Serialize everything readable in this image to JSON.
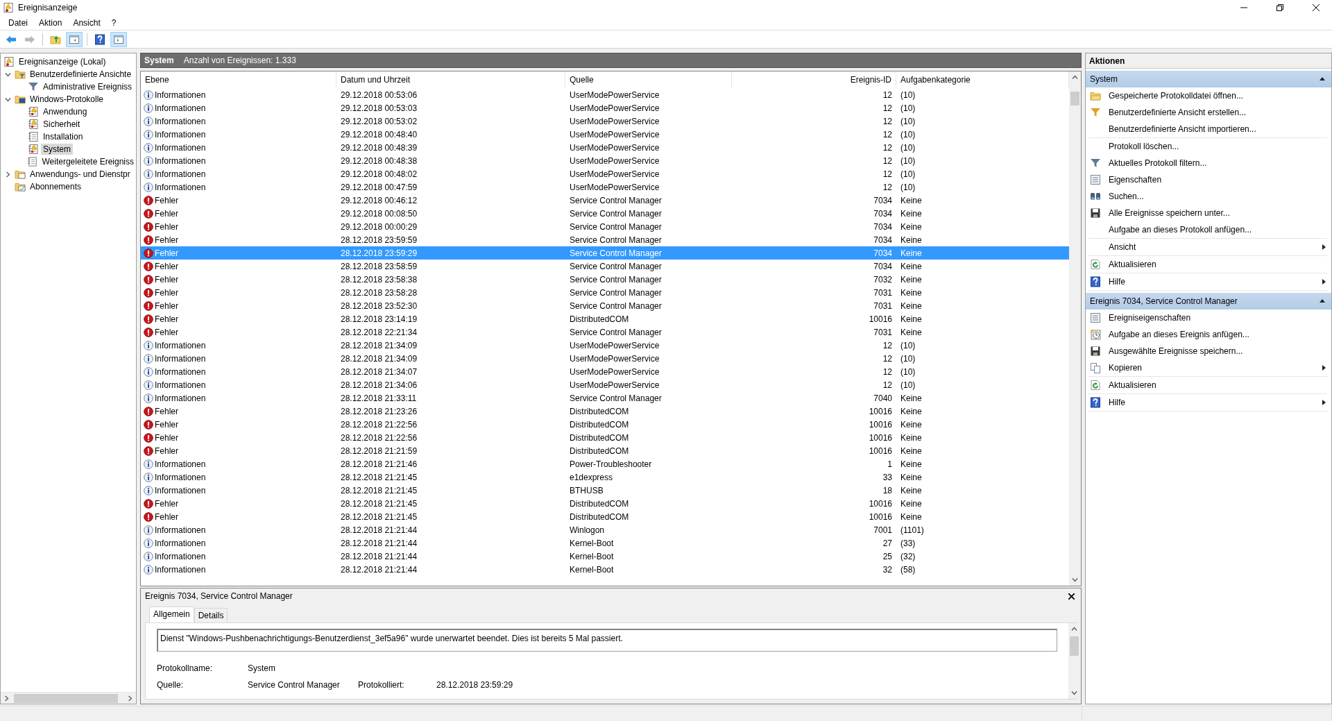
{
  "window": {
    "title": "Ereignisanzeige"
  },
  "menu": [
    "Datei",
    "Aktion",
    "Ansicht",
    "?"
  ],
  "toolbar": [
    {
      "kind": "back",
      "disabled": false,
      "pressed": false
    },
    {
      "kind": "forward",
      "disabled": true,
      "pressed": false
    },
    {
      "kind": "separator"
    },
    {
      "kind": "up-folder",
      "disabled": false,
      "pressed": false
    },
    {
      "kind": "tree-pane",
      "disabled": false,
      "pressed": true
    },
    {
      "kind": "separator"
    },
    {
      "kind": "help",
      "disabled": false,
      "pressed": false
    },
    {
      "kind": "action-pane",
      "disabled": false,
      "pressed": true
    }
  ],
  "tree": [
    {
      "label": "Ereignisanzeige (Lokal)",
      "kind": "viewer",
      "selected": false,
      "children": [
        {
          "label": "Benutzerdefinierte Ansichte",
          "kind": "folder-filter",
          "selected": false,
          "expanded": true,
          "children": [
            {
              "label": "Administrative Ereigniss",
              "kind": "filter",
              "selected": false
            }
          ]
        },
        {
          "label": "Windows-Protokolle",
          "kind": "folder-computer",
          "selected": false,
          "expanded": true,
          "children": [
            {
              "label": "Anwendung",
              "kind": "log-warning",
              "selected": false
            },
            {
              "label": "Sicherheit",
              "kind": "log-warning",
              "selected": false
            },
            {
              "label": "Installation",
              "kind": "log",
              "selected": false
            },
            {
              "label": "System",
              "kind": "log-warning",
              "selected": true
            },
            {
              "label": "Weitergeleitete Ereigniss",
              "kind": "log",
              "selected": false
            }
          ]
        },
        {
          "label": "Anwendungs- und Dienstpr",
          "kind": "folder-window",
          "selected": false,
          "expanded": false
        },
        {
          "label": "Abonnements",
          "kind": "folder-subscription",
          "selected": false
        }
      ]
    }
  ],
  "content": {
    "title": "System",
    "count": "Anzahl von Ereignissen: 1.333"
  },
  "table": {
    "columns": [
      "Ebene",
      "Datum und Uhrzeit",
      "Quelle",
      "Ereignis-ID",
      "Aufgabenkategorie"
    ],
    "rows": [
      {
        "kind": "info",
        "severity": "Informationen",
        "date": "29.12.2018 00:53:06",
        "source": "UserModePowerService",
        "id": "12",
        "category": "(10)",
        "selected": false
      },
      {
        "kind": "info",
        "severity": "Informationen",
        "date": "29.12.2018 00:53:03",
        "source": "UserModePowerService",
        "id": "12",
        "category": "(10)",
        "selected": false
      },
      {
        "kind": "info",
        "severity": "Informationen",
        "date": "29.12.2018 00:53:02",
        "source": "UserModePowerService",
        "id": "12",
        "category": "(10)",
        "selected": false
      },
      {
        "kind": "info",
        "severity": "Informationen",
        "date": "29.12.2018 00:48:40",
        "source": "UserModePowerService",
        "id": "12",
        "category": "(10)",
        "selected": false
      },
      {
        "kind": "info",
        "severity": "Informationen",
        "date": "29.12.2018 00:48:39",
        "source": "UserModePowerService",
        "id": "12",
        "category": "(10)",
        "selected": false
      },
      {
        "kind": "info",
        "severity": "Informationen",
        "date": "29.12.2018 00:48:38",
        "source": "UserModePowerService",
        "id": "12",
        "category": "(10)",
        "selected": false
      },
      {
        "kind": "info",
        "severity": "Informationen",
        "date": "29.12.2018 00:48:02",
        "source": "UserModePowerService",
        "id": "12",
        "category": "(10)",
        "selected": false
      },
      {
        "kind": "info",
        "severity": "Informationen",
        "date": "29.12.2018 00:47:59",
        "source": "UserModePowerService",
        "id": "12",
        "category": "(10)",
        "selected": false
      },
      {
        "kind": "error",
        "severity": "Fehler",
        "date": "29.12.2018 00:46:12",
        "source": "Service Control Manager",
        "id": "7034",
        "category": "Keine",
        "selected": false
      },
      {
        "kind": "error",
        "severity": "Fehler",
        "date": "29.12.2018 00:08:50",
        "source": "Service Control Manager",
        "id": "7034",
        "category": "Keine",
        "selected": false
      },
      {
        "kind": "error",
        "severity": "Fehler",
        "date": "29.12.2018 00:00:29",
        "source": "Service Control Manager",
        "id": "7034",
        "category": "Keine",
        "selected": false
      },
      {
        "kind": "error",
        "severity": "Fehler",
        "date": "28.12.2018 23:59:59",
        "source": "Service Control Manager",
        "id": "7034",
        "category": "Keine",
        "selected": false
      },
      {
        "kind": "error",
        "severity": "Fehler",
        "date": "28.12.2018 23:59:29",
        "source": "Service Control Manager",
        "id": "7034",
        "category": "Keine",
        "selected": true
      },
      {
        "kind": "error",
        "severity": "Fehler",
        "date": "28.12.2018 23:58:59",
        "source": "Service Control Manager",
        "id": "7034",
        "category": "Keine",
        "selected": false
      },
      {
        "kind": "error",
        "severity": "Fehler",
        "date": "28.12.2018 23:58:38",
        "source": "Service Control Manager",
        "id": "7032",
        "category": "Keine",
        "selected": false
      },
      {
        "kind": "error",
        "severity": "Fehler",
        "date": "28.12.2018 23:58:28",
        "source": "Service Control Manager",
        "id": "7031",
        "category": "Keine",
        "selected": false
      },
      {
        "kind": "error",
        "severity": "Fehler",
        "date": "28.12.2018 23:52:30",
        "source": "Service Control Manager",
        "id": "7031",
        "category": "Keine",
        "selected": false
      },
      {
        "kind": "error",
        "severity": "Fehler",
        "date": "28.12.2018 23:14:19",
        "source": "DistributedCOM",
        "id": "10016",
        "category": "Keine",
        "selected": false
      },
      {
        "kind": "error",
        "severity": "Fehler",
        "date": "28.12.2018 22:21:34",
        "source": "Service Control Manager",
        "id": "7031",
        "category": "Keine",
        "selected": false
      },
      {
        "kind": "info",
        "severity": "Informationen",
        "date": "28.12.2018 21:34:09",
        "source": "UserModePowerService",
        "id": "12",
        "category": "(10)",
        "selected": false
      },
      {
        "kind": "info",
        "severity": "Informationen",
        "date": "28.12.2018 21:34:09",
        "source": "UserModePowerService",
        "id": "12",
        "category": "(10)",
        "selected": false
      },
      {
        "kind": "info",
        "severity": "Informationen",
        "date": "28.12.2018 21:34:07",
        "source": "UserModePowerService",
        "id": "12",
        "category": "(10)",
        "selected": false
      },
      {
        "kind": "info",
        "severity": "Informationen",
        "date": "28.12.2018 21:34:06",
        "source": "UserModePowerService",
        "id": "12",
        "category": "(10)",
        "selected": false
      },
      {
        "kind": "info",
        "severity": "Informationen",
        "date": "28.12.2018 21:33:11",
        "source": "Service Control Manager",
        "id": "7040",
        "category": "Keine",
        "selected": false
      },
      {
        "kind": "error",
        "severity": "Fehler",
        "date": "28.12.2018 21:23:26",
        "source": "DistributedCOM",
        "id": "10016",
        "category": "Keine",
        "selected": false
      },
      {
        "kind": "error",
        "severity": "Fehler",
        "date": "28.12.2018 21:22:56",
        "source": "DistributedCOM",
        "id": "10016",
        "category": "Keine",
        "selected": false
      },
      {
        "kind": "error",
        "severity": "Fehler",
        "date": "28.12.2018 21:22:56",
        "source": "DistributedCOM",
        "id": "10016",
        "category": "Keine",
        "selected": false
      },
      {
        "kind": "error",
        "severity": "Fehler",
        "date": "28.12.2018 21:21:59",
        "source": "DistributedCOM",
        "id": "10016",
        "category": "Keine",
        "selected": false
      },
      {
        "kind": "info",
        "severity": "Informationen",
        "date": "28.12.2018 21:21:46",
        "source": "Power-Troubleshooter",
        "id": "1",
        "category": "Keine",
        "selected": false
      },
      {
        "kind": "info",
        "severity": "Informationen",
        "date": "28.12.2018 21:21:45",
        "source": "e1dexpress",
        "id": "33",
        "category": "Keine",
        "selected": false
      },
      {
        "kind": "info",
        "severity": "Informationen",
        "date": "28.12.2018 21:21:45",
        "source": "BTHUSB",
        "id": "18",
        "category": "Keine",
        "selected": false
      },
      {
        "kind": "error",
        "severity": "Fehler",
        "date": "28.12.2018 21:21:45",
        "source": "DistributedCOM",
        "id": "10016",
        "category": "Keine",
        "selected": false
      },
      {
        "kind": "error",
        "severity": "Fehler",
        "date": "28.12.2018 21:21:45",
        "source": "DistributedCOM",
        "id": "10016",
        "category": "Keine",
        "selected": false
      },
      {
        "kind": "info",
        "severity": "Informationen",
        "date": "28.12.2018 21:21:44",
        "source": "Winlogon",
        "id": "7001",
        "category": "(1101)",
        "selected": false
      },
      {
        "kind": "info",
        "severity": "Informationen",
        "date": "28.12.2018 21:21:44",
        "source": "Kernel-Boot",
        "id": "27",
        "category": "(33)",
        "selected": false
      },
      {
        "kind": "info",
        "severity": "Informationen",
        "date": "28.12.2018 21:21:44",
        "source": "Kernel-Boot",
        "id": "25",
        "category": "(32)",
        "selected": false
      },
      {
        "kind": "info",
        "severity": "Informationen",
        "date": "28.12.2018 21:21:44",
        "source": "Kernel-Boot",
        "id": "32",
        "category": "(58)",
        "selected": false
      }
    ]
  },
  "detail": {
    "title": "Ereignis 7034, Service Control Manager",
    "tabs": [
      {
        "label": "Allgemein",
        "selected": true
      },
      {
        "label": "Details",
        "selected": false
      }
    ],
    "message": "Dienst \"Windows-Pushbenachrichtigungs-Benutzerdienst_3ef5a96\" wurde unerwartet beendet. Dies ist bereits 5 Mal passiert.",
    "fields": [
      [
        {
          "label": "Protokollname:",
          "value": "System"
        }
      ],
      [
        {
          "label": "Quelle:",
          "value": "Service Control Manager"
        },
        {
          "label": "Protokolliert:",
          "value": "28.12.2018 23:59:29"
        }
      ]
    ]
  },
  "actions": {
    "title": "Aktionen",
    "sections": [
      {
        "title": "System",
        "expanded": true,
        "groups": [
          [
            {
              "label": "Gespeicherte Protokolldatei öffnen...",
              "kind": "open",
              "submenu": false
            },
            {
              "label": "Benutzerdefinierte Ansicht erstellen...",
              "kind": "filter-new",
              "submenu": false
            },
            {
              "label": "Benutzerdefinierte Ansicht importieren...",
              "kind": "plain",
              "submenu": false
            }
          ],
          [
            {
              "label": "Protokoll löschen...",
              "kind": "plain",
              "submenu": false
            },
            {
              "label": "Aktuelles Protokoll filtern...",
              "kind": "filter",
              "submenu": false
            },
            {
              "label": "Eigenschaften",
              "kind": "properties",
              "submenu": false
            },
            {
              "label": "Suchen...",
              "kind": "find",
              "submenu": false
            },
            {
              "label": "Alle Ereignisse speichern unter...",
              "kind": "save",
              "submenu": false
            },
            {
              "label": "Aufgabe an dieses Protokoll anfügen...",
              "kind": "plain",
              "submenu": false
            }
          ],
          [
            {
              "label": "Ansicht",
              "kind": "plain",
              "submenu": true
            }
          ],
          [
            {
              "label": "Aktualisieren",
              "kind": "refresh",
              "submenu": false
            }
          ],
          [
            {
              "label": "Hilfe",
              "kind": "help",
              "submenu": true
            }
          ]
        ]
      },
      {
        "title": "Ereignis 7034, Service Control Manager",
        "expanded": true,
        "groups": [
          [
            {
              "label": "Ereigniseigenschaften",
              "kind": "properties",
              "submenu": false
            },
            {
              "label": "Aufgabe an dieses Ereignis anfügen...",
              "kind": "task",
              "submenu": false
            },
            {
              "label": "Ausgewählte Ereignisse speichern...",
              "kind": "save",
              "submenu": false
            },
            {
              "label": "Kopieren",
              "kind": "copy",
              "submenu": true
            }
          ],
          [
            {
              "label": "Aktualisieren",
              "kind": "refresh",
              "submenu": false
            }
          ],
          [
            {
              "label": "Hilfe",
              "kind": "help",
              "submenu": true
            }
          ]
        ]
      }
    ]
  }
}
